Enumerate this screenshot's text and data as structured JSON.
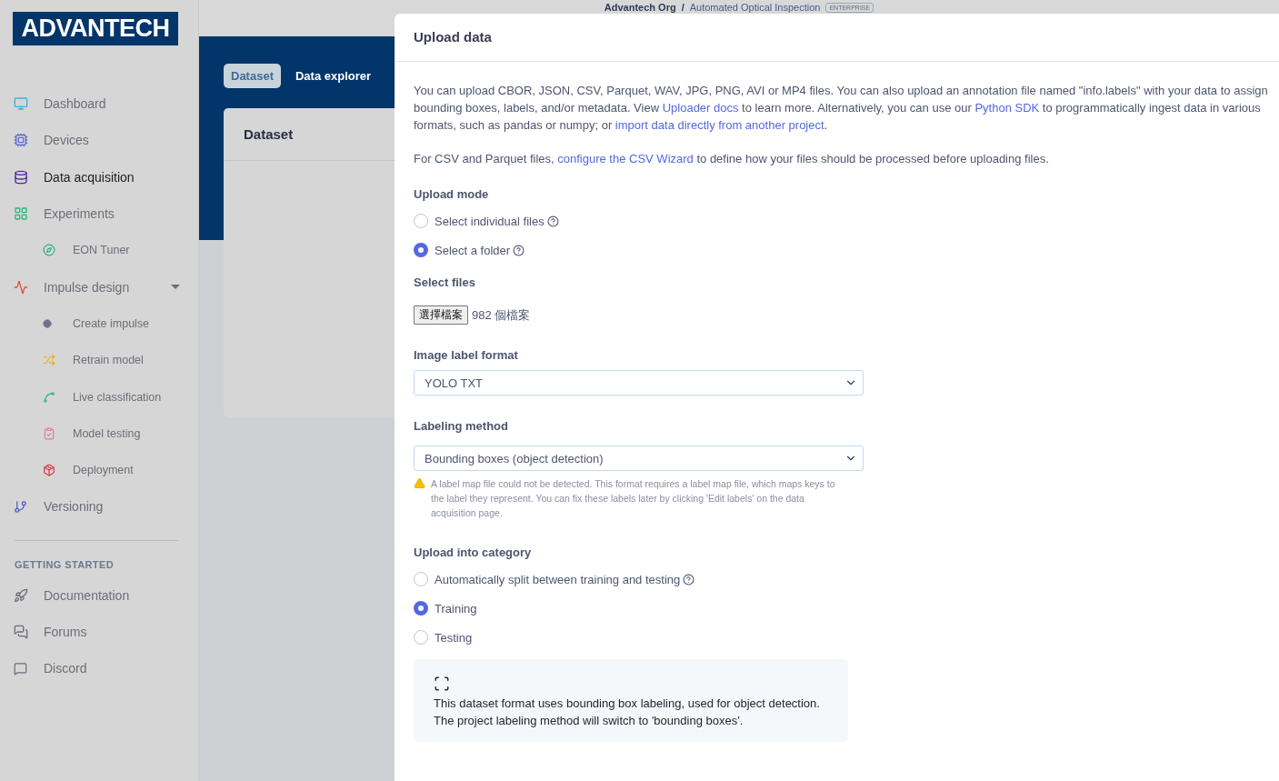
{
  "logo": "ADVANTECH",
  "breadcrumb": {
    "org": "Advantech Org",
    "separator": "/",
    "project": "Automated Optical Inspection",
    "badge": "ENTERPRISE"
  },
  "sidebar": {
    "items": [
      {
        "label": "Dashboard",
        "selected": false
      },
      {
        "label": "Devices",
        "selected": false
      },
      {
        "label": "Data acquisition",
        "selected": true
      },
      {
        "label": "Experiments",
        "selected": false,
        "children": [
          {
            "label": "EON Tuner",
            "selected": false
          }
        ]
      },
      {
        "label": "Impulse design",
        "selected": false,
        "expanded": true,
        "children": [
          {
            "label": "Create impulse",
            "selected": false
          },
          {
            "label": "Retrain model",
            "selected": false
          },
          {
            "label": "Live classification",
            "selected": false
          },
          {
            "label": "Model testing",
            "selected": false
          },
          {
            "label": "Deployment",
            "selected": false
          }
        ]
      },
      {
        "label": "Versioning",
        "selected": false
      }
    ],
    "section_title": "GETTING STARTED",
    "links": [
      {
        "label": "Documentation"
      },
      {
        "label": "Forums"
      },
      {
        "label": "Discord"
      }
    ]
  },
  "tabs": [
    {
      "label": "Dataset",
      "selected": true
    },
    {
      "label": "Data explorer",
      "selected": false
    }
  ],
  "card": {
    "title": "Dataset"
  },
  "modal": {
    "title": "Upload data",
    "intro": [
      {
        "kind": "text",
        "text": "You can upload CBOR, JSON, CSV, Parquet, WAV, JPG, PNG, AVI or MP4 files. You can also upload an annotation file named \"info.labels\" with your data to assign bounding boxes, labels, and/or metadata. View "
      },
      {
        "kind": "link",
        "text": "Uploader docs"
      },
      {
        "kind": "text",
        "text": " to learn more. Alternatively, you can use our "
      },
      {
        "kind": "link",
        "text": "Python SDK"
      },
      {
        "kind": "text",
        "text": " to programmatically ingest data in various formats, such as pandas or numpy; or "
      },
      {
        "kind": "link",
        "text": "import data directly from another project"
      },
      {
        "kind": "text",
        "text": "."
      }
    ],
    "csv_note": [
      {
        "kind": "text",
        "text": "For CSV and Parquet files, "
      },
      {
        "kind": "link",
        "text": "configure the CSV Wizard"
      },
      {
        "kind": "text",
        "text": " to define how your files should be processed before uploading files."
      }
    ],
    "upload_mode": {
      "label": "Upload mode",
      "options": [
        {
          "label": "Select individual files",
          "selected": false,
          "help": true
        },
        {
          "label": "Select a folder",
          "selected": true,
          "help": true
        }
      ]
    },
    "select_files": {
      "label": "Select files",
      "button": "選擇檔案",
      "status": "982 個檔案"
    },
    "image_label_format": {
      "label": "Image label format",
      "value": "YOLO TXT"
    },
    "labeling_method": {
      "label": "Labeling method",
      "value": "Bounding boxes (object detection)"
    },
    "warning": "A label map file could not be detected. This format requires a label map file, which maps keys to the label they represent. You can fix these labels later by clicking 'Edit labels' on the data acquisition page.",
    "category": {
      "label": "Upload into category",
      "options": [
        {
          "label": "Automatically split between training and testing",
          "selected": false,
          "help": true
        },
        {
          "label": "Training",
          "selected": true,
          "help": false
        },
        {
          "label": "Testing",
          "selected": false,
          "help": false
        }
      ]
    },
    "info_box": "This dataset format uses bounding box labeling, used for object detection. The project labeling method will switch to 'bounding boxes'."
  }
}
